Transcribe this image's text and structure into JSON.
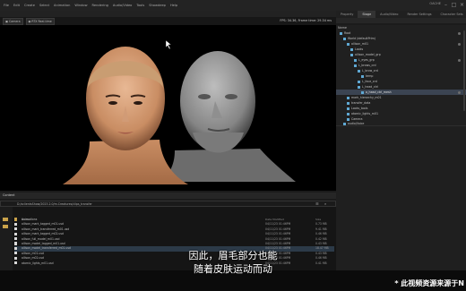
{
  "menubar": {
    "items": [
      "File",
      "Edit",
      "Create",
      "Select",
      "Animation",
      "Window",
      "Rendering",
      "Audio/Video",
      "Tools",
      "Showdeep",
      "Help"
    ]
  },
  "window": {
    "title": "OACHE",
    "min": "–",
    "max": "□",
    "close": "×"
  },
  "viewport": {
    "camera_label": "Camera",
    "render_mode_label": "RTX Real-time",
    "fps_text": "FPS: 34.36, Frame time: 29.34 ms"
  },
  "right_panel": {
    "tabs": [
      "Property",
      "Stage",
      "Audio/Video",
      "Render Settings",
      "Character Sets"
    ],
    "active_tab": "Stage",
    "tree_header": "Name",
    "tree": [
      "Root",
      "World (defaultPrim)",
      "allison_m01",
      "Looks",
      "allison_model_grp",
      "L_eyes_grp",
      "L_brows_crd",
      "L_brow_crd",
      "temp",
      "L_face_crd",
      "L_head_ctrl",
      "a_head_ctrl_mesh",
      "mark_hierarchy_m01",
      "transfer_data",
      "Looks_tools",
      "atomic_lights_m01",
      "Camera",
      "audio/Voice"
    ]
  },
  "content_browser": {
    "title": "Content",
    "path": "D:/sclientsShow/2023.2.0/m.Creatures/clips_transfer",
    "columns": [
      "Name",
      "Date Modified",
      "Size"
    ],
    "files": [
      {
        "name": "Animations",
        "date": "",
        "size": ""
      },
      {
        "name": "allison_mark_tagged_m01.usd",
        "date": "04/11/23 01:46PM",
        "size": "0.73 MB"
      },
      {
        "name": "allison_mark_transferred_m01.usd",
        "date": "04/11/23 01:46PM",
        "size": "9.41 MB"
      },
      {
        "name": "allison_mark_tagged_m02.usd",
        "date": "04/11/23 01:46PM",
        "size": "0.46 MB"
      },
      {
        "name": "allison_full_model_m01.usd",
        "date": "04/11/23 01:46PM",
        "size": "0.42 MB"
      },
      {
        "name": "allison_model_tagged_m01.usd",
        "date": "04/11/23 01:46PM",
        "size": "0.43 MB"
      },
      {
        "name": "allison_model_transferred_m01.usd",
        "date": "04/11/23 01:46PM",
        "size": "18.47 MB"
      },
      {
        "name": "allison_m01.usd",
        "date": "04/11/23 01:46PM",
        "size": "0.43 MB"
      },
      {
        "name": "allison_m02.usd",
        "date": "04/11/23 01:46PM",
        "size": "0.46 MB"
      },
      {
        "name": "atomic_lights_m01.usd",
        "date": "04/11/23 01:46PM",
        "size": "0.41 MB"
      }
    ]
  },
  "subtitle": {
    "line1": "因此，眉毛部分也能",
    "line2": "随着皮肤运动而动"
  },
  "watermark": "* 此视频资源来源于N",
  "colors": {
    "skin": "#d8a27a",
    "grey_mesh": "#8e8e8e",
    "selection": "#3b4452"
  }
}
